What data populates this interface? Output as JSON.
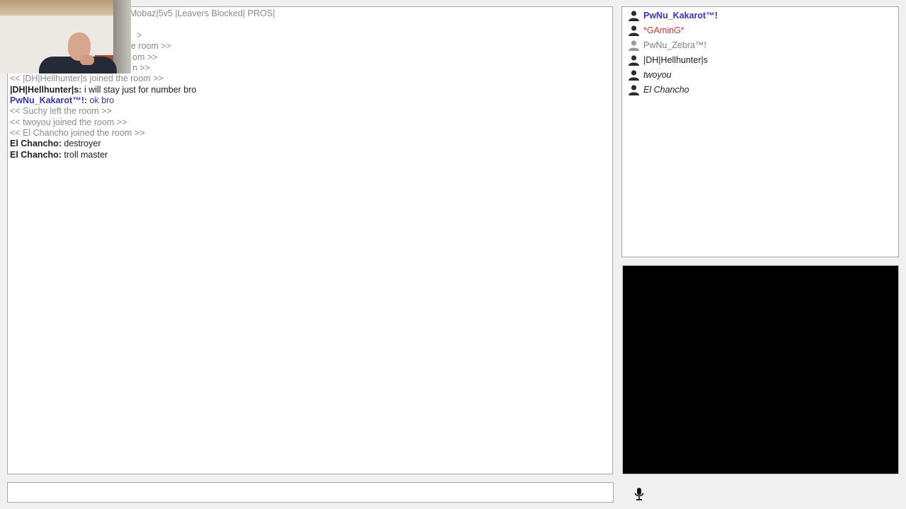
{
  "chat": {
    "lines": [
      {
        "type": "system",
        "text": "Mobaz|5v5 |Leavers Blocked| PROS|"
      },
      {
        "type": "system",
        "text": ">"
      },
      {
        "type": "system",
        "text": "e room >>"
      },
      {
        "type": "system",
        "text": "om >>"
      },
      {
        "type": "system",
        "text": "n >>"
      },
      {
        "type": "system",
        "text": "<< |DH|Hellhunter|s joined the room >>"
      },
      {
        "nick": "|DH|Hellhunter|s:",
        "text": " i will stay just for number bro"
      },
      {
        "nick": "PwNu_Kakarot™!:",
        "text": " ok bro"
      },
      {
        "type": "system",
        "text": "<< Suchy left the room >>"
      },
      {
        "type": "system",
        "text": "<< twoyou joined the room >>"
      },
      {
        "type": "system",
        "text": "<< El Chancho joined the room >>"
      },
      {
        "nick": "El Chancho:",
        "text": " destroyer"
      },
      {
        "nick": "El Chancho:",
        "text": " troll master"
      }
    ]
  },
  "users": [
    {
      "name": "PwNu_Kakarot™!",
      "color": "#3333cc",
      "style": "bold",
      "icon": "user-icon"
    },
    {
      "name": "*GAminG*",
      "color": "#e03030",
      "style": "normal",
      "icon": "user-icon"
    },
    {
      "name": "PwNu_Zebra™!",
      "color": "#808080",
      "style": "normal",
      "icon": "user-icon-inactive"
    },
    {
      "name": "|DH|Hellhunter|s",
      "color": "#222222",
      "style": "normal",
      "icon": "user-icon"
    },
    {
      "name": "twoyou",
      "color": "#222222",
      "style": "italic",
      "icon": "user-icon"
    },
    {
      "name": "El Chancho",
      "color": "#222222",
      "style": "italic",
      "icon": "user-icon"
    }
  ],
  "input": {
    "value": "",
    "placeholder": ""
  },
  "mic": {
    "icon": "microphone-icon"
  },
  "colors": {
    "own_nick": "#3535c8",
    "system_text": "#8a8a8a",
    "video_background": "#000000"
  }
}
